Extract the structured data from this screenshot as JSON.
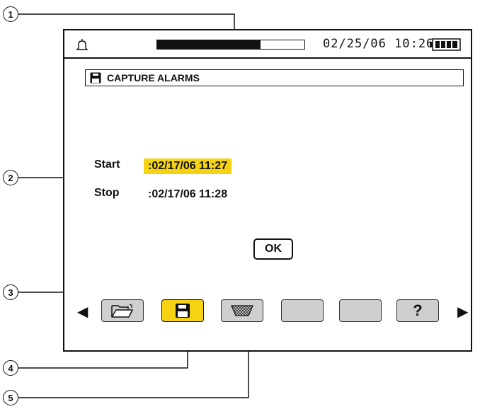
{
  "callouts": [
    "1",
    "2",
    "3",
    "4",
    "5"
  ],
  "status_bar": {
    "icon": "bell-icon",
    "progress_fraction": 0.7,
    "datetime": "02/25/06 10:26",
    "battery_icon": "battery-full-icon"
  },
  "title": {
    "icon": "floppy-disk-icon",
    "text": "CAPTURE ALARMS"
  },
  "fields": {
    "start": {
      "label": "Start",
      "value": ":02/17/06  11:27"
    },
    "stop": {
      "label": "Stop",
      "value": ":02/17/06  11:28"
    }
  },
  "ok_button": {
    "label": "OK"
  },
  "toolbar": {
    "left_arrow": "◀",
    "right_arrow": "▶",
    "buttons": [
      {
        "icon": "open-folder-icon",
        "active": false
      },
      {
        "icon": "floppy-disk-icon",
        "active": true
      },
      {
        "icon": "eraser-icon",
        "active": false
      },
      {
        "icon": "",
        "active": false
      },
      {
        "icon": "",
        "active": false
      },
      {
        "icon": "help-icon",
        "label": "?",
        "active": false
      }
    ]
  },
  "colors": {
    "highlight": "#f6d312",
    "button_gray": "#cfcfcf",
    "ink": "#111111"
  }
}
